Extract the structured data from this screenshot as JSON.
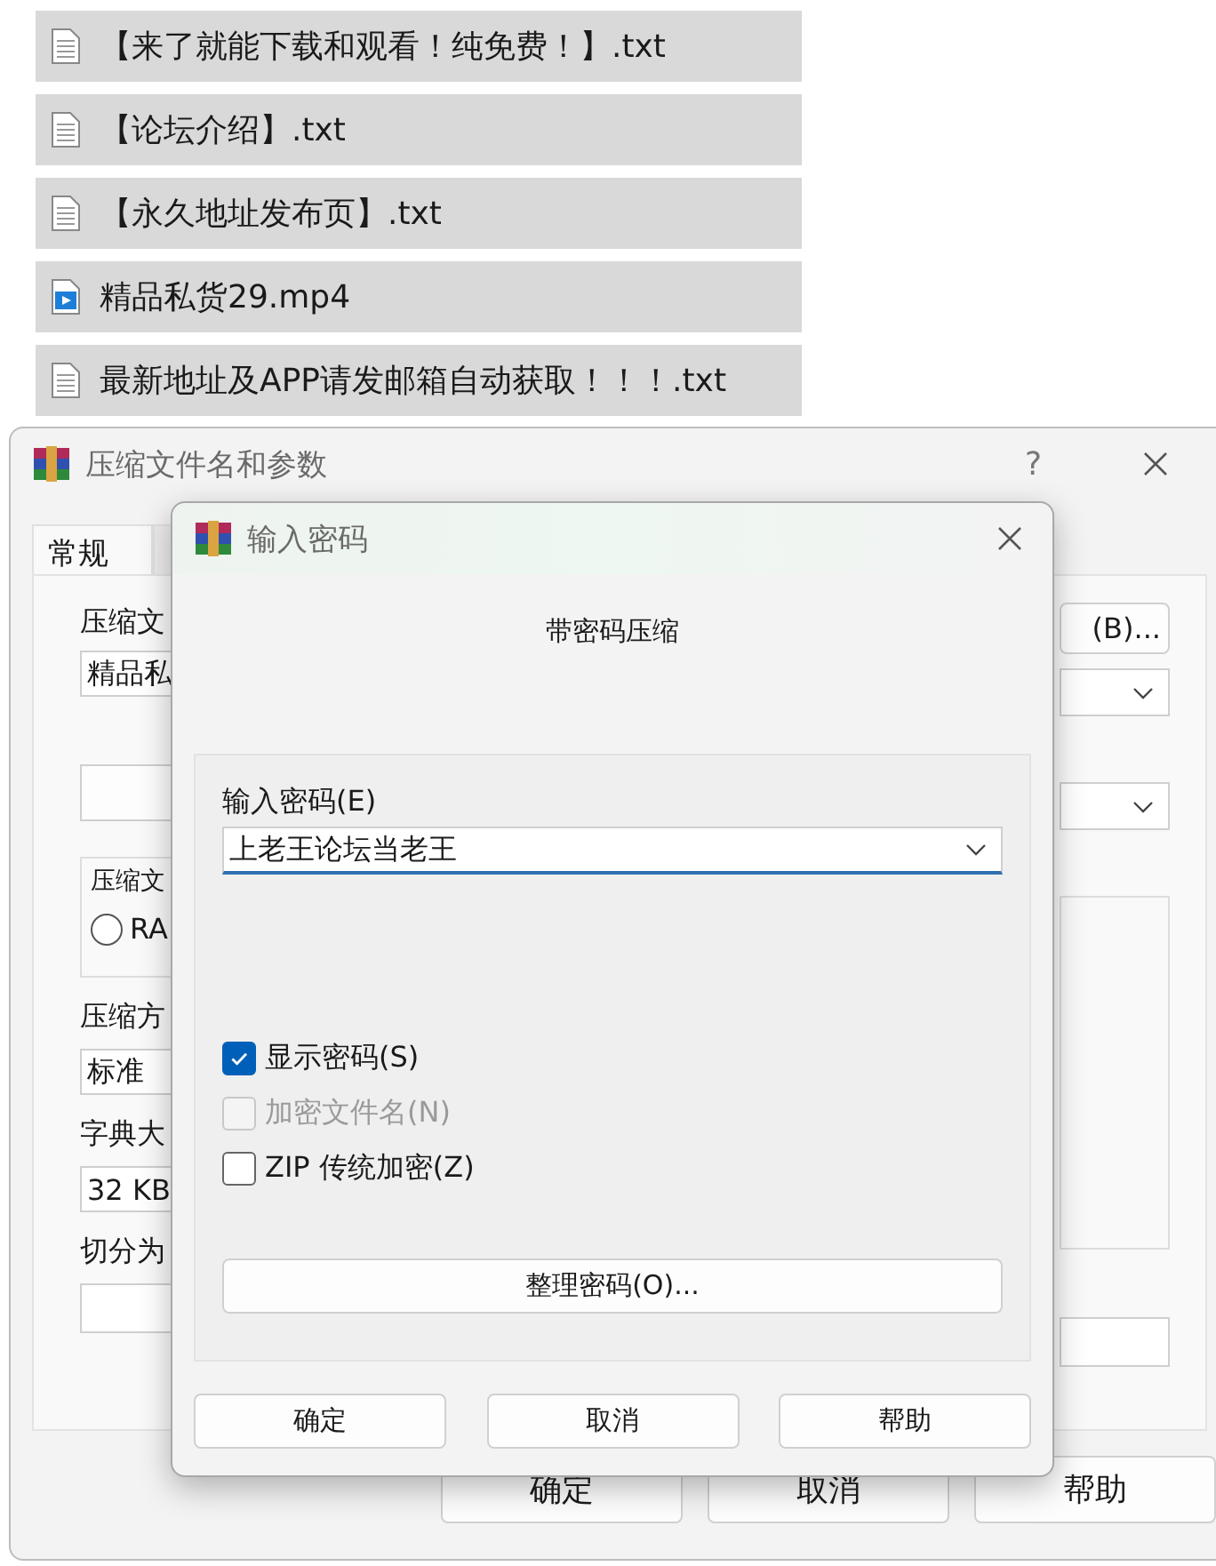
{
  "files": [
    {
      "name": "【来了就能下载和观看！纯免费！】.txt",
      "kind": "text"
    },
    {
      "name": "【论坛介绍】.txt",
      "kind": "text"
    },
    {
      "name": "【永久地址发布页】.txt",
      "kind": "text"
    },
    {
      "name": "精品私货29.mp4",
      "kind": "video"
    },
    {
      "name": "最新地址及APP请发邮箱自动获取！！！.txt",
      "kind": "text"
    }
  ],
  "archive_dialog": {
    "title": "压缩文件名和参数",
    "help": "?",
    "tabs": [
      {
        "label": "常规",
        "selected": true
      }
    ],
    "archive_name_label": "压缩文",
    "archive_name_value": "精品私",
    "browse_button": "(B)...",
    "format_group_label": "压缩文",
    "format_option": {
      "label": "RA",
      "selected": false
    },
    "method_label": "压缩方",
    "method_value": "标准",
    "dictionary_label": "字典大",
    "dictionary_value": "32 KB",
    "split_label": "切分为",
    "buttons": [
      "确定",
      "取消",
      "帮助"
    ]
  },
  "password_dialog": {
    "title": "输入密码",
    "heading": "带密码压缩",
    "password_label": "输入密码(E)",
    "password_value": "上老王论坛当老王",
    "options": [
      {
        "label": "显示密码(S)",
        "checked": true,
        "disabled": false
      },
      {
        "label": "加密文件名(N)",
        "checked": false,
        "disabled": true
      },
      {
        "label": "ZIP 传统加密(Z)",
        "checked": false,
        "disabled": false
      }
    ],
    "organize_button": "整理密码(O)...",
    "buttons": [
      "确定",
      "取消",
      "帮助"
    ]
  }
}
